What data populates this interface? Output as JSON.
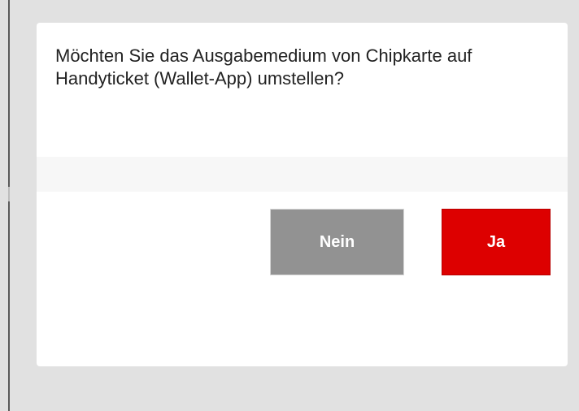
{
  "dialog": {
    "message": "Möchten Sie das Ausgabemedium von Chipkarte auf Handyticket (Wallet-App) umstellen?",
    "buttons": {
      "no_label": "Nein",
      "yes_label": "Ja"
    }
  },
  "colors": {
    "backdrop": "#e1e1e1",
    "dialog_background": "#ffffff",
    "separator": "#f7f7f7",
    "no_button": "#929292",
    "yes_button": "#dd0000",
    "button_text": "#ffffff"
  }
}
